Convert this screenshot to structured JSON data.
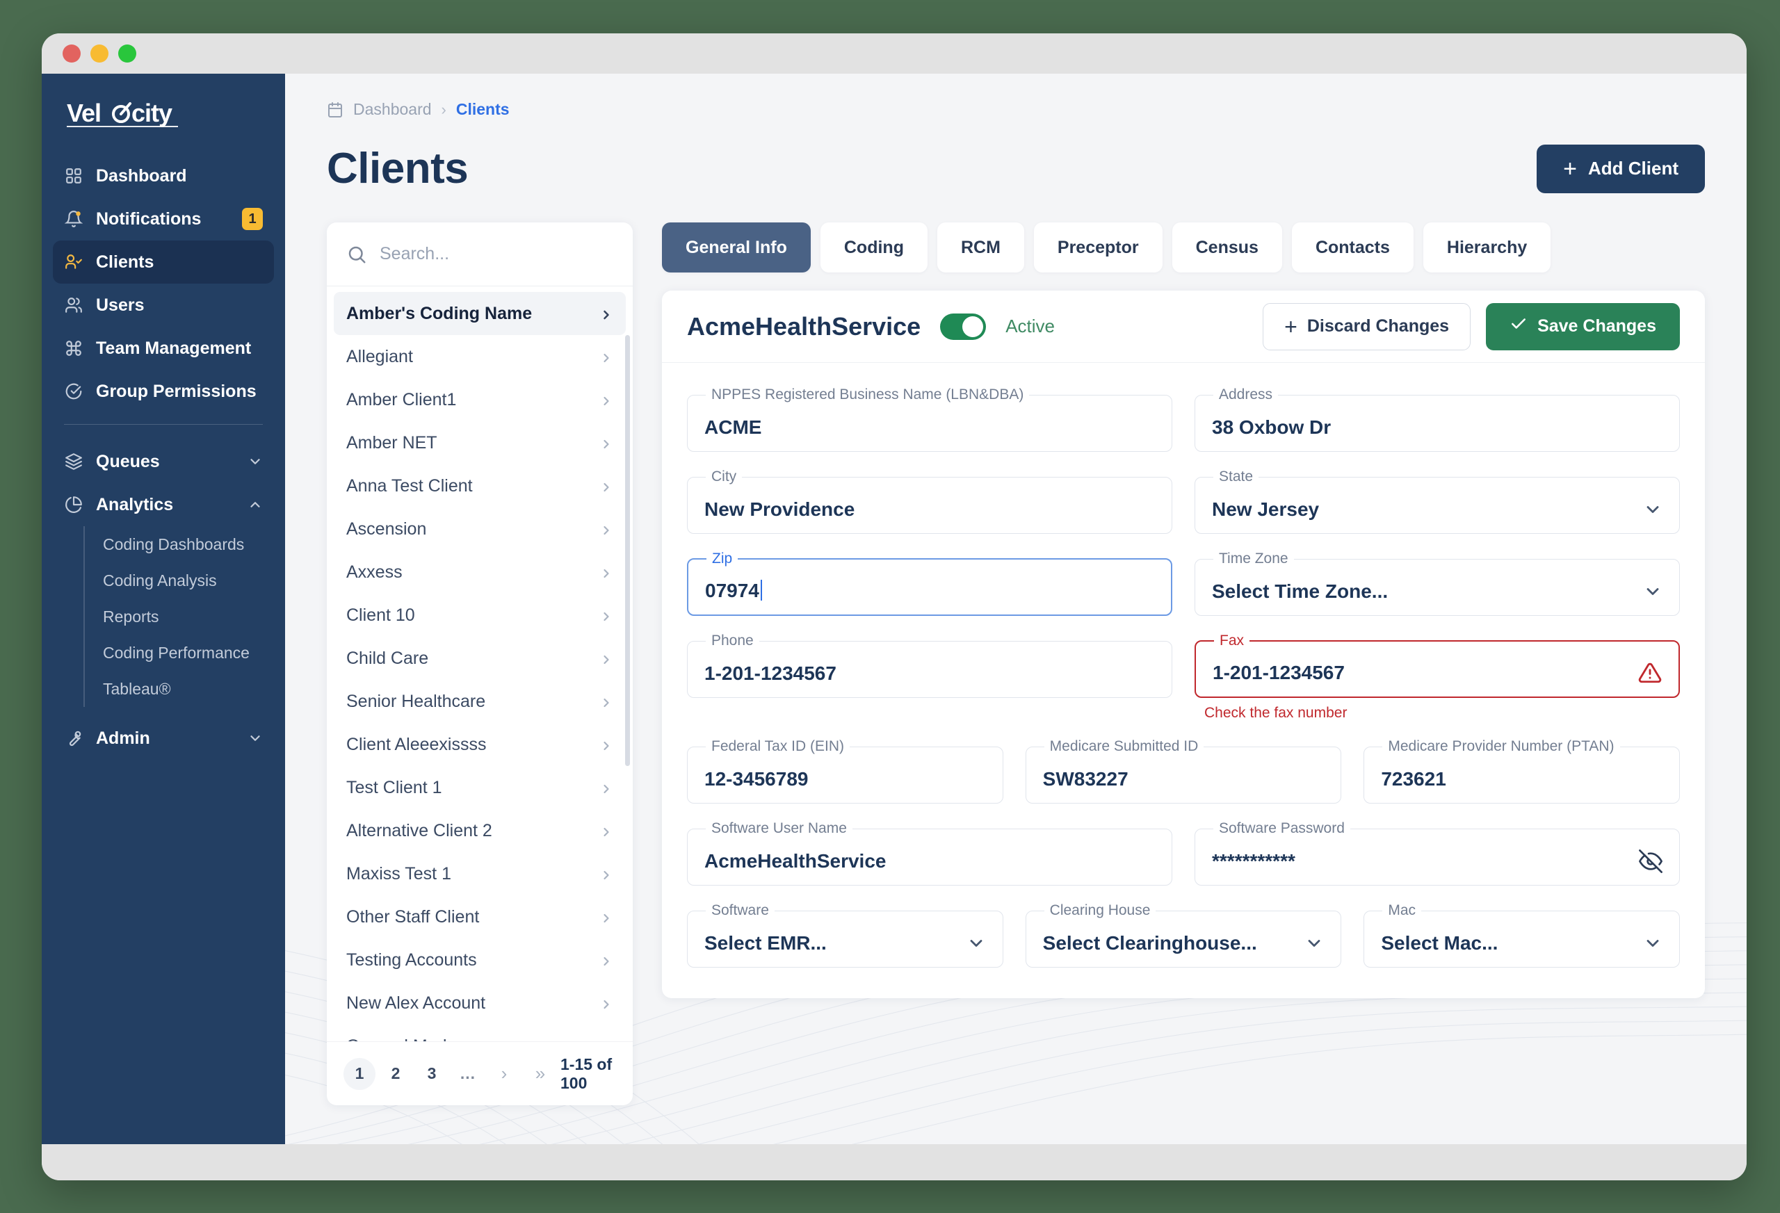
{
  "window": {
    "traffic_lights": [
      "close",
      "minimize",
      "maximize"
    ]
  },
  "sidebar": {
    "brand": "Velocity",
    "items": [
      {
        "label": "Dashboard",
        "icon": "grid-icon",
        "active": false
      },
      {
        "label": "Notifications",
        "icon": "bell-icon",
        "active": false,
        "badge": "1"
      },
      {
        "label": "Clients",
        "icon": "user-check-icon",
        "active": true
      },
      {
        "label": "Users",
        "icon": "users-icon",
        "active": false
      },
      {
        "label": "Team Management",
        "icon": "command-icon",
        "active": false
      },
      {
        "label": "Group Permissions",
        "icon": "check-circle-icon",
        "active": false
      }
    ],
    "groups": [
      {
        "label": "Queues",
        "icon": "layers-icon",
        "expanded": false,
        "chevron": "chevron-down-icon",
        "children": []
      },
      {
        "label": "Analytics",
        "icon": "pie-chart-icon",
        "expanded": true,
        "chevron": "chevron-up-icon",
        "children": [
          "Coding Dashboards",
          "Coding Analysis",
          "Reports",
          "Coding Performance",
          "Tableau®"
        ]
      },
      {
        "label": "Admin",
        "icon": "wrench-icon",
        "expanded": false,
        "chevron": "chevron-down-icon",
        "children": []
      }
    ]
  },
  "breadcrumb": {
    "icon": "calendar-icon",
    "root": "Dashboard",
    "separator": "›",
    "current": "Clients"
  },
  "page": {
    "title": "Clients",
    "add_button": "Add Client",
    "add_button_icon": "plus-icon"
  },
  "client_list": {
    "search_placeholder": "Search...",
    "search_value": "",
    "search_icon": "search-icon",
    "items": [
      {
        "name": "Amber's Coding Name",
        "selected": true
      },
      {
        "name": "Allegiant",
        "selected": false
      },
      {
        "name": "Amber Client1",
        "selected": false
      },
      {
        "name": "Amber NET",
        "selected": false
      },
      {
        "name": "Anna Test Client",
        "selected": false
      },
      {
        "name": "Ascension",
        "selected": false
      },
      {
        "name": "Axxess",
        "selected": false
      },
      {
        "name": "Client 10",
        "selected": false
      },
      {
        "name": "Child Care",
        "selected": false
      },
      {
        "name": "Senior Healthcare",
        "selected": false
      },
      {
        "name": "Client Aleeexissss",
        "selected": false
      },
      {
        "name": "Test Client 1",
        "selected": false
      },
      {
        "name": "Alternative Client 2",
        "selected": false
      },
      {
        "name": "Maxiss Test 1",
        "selected": false
      },
      {
        "name": "Other Staff Client",
        "selected": false
      },
      {
        "name": "Testing Accounts",
        "selected": false
      },
      {
        "name": "New Alex Account",
        "selected": false
      },
      {
        "name": "General Med",
        "selected": false
      }
    ],
    "pagination": {
      "pages": [
        "1",
        "2",
        "3"
      ],
      "current": "1",
      "ellipsis": "...",
      "next_icon": "›",
      "last_icon": "»",
      "summary": "1-15 of 100"
    }
  },
  "tabs": [
    {
      "label": "General Info",
      "active": true
    },
    {
      "label": "Coding",
      "active": false
    },
    {
      "label": "RCM",
      "active": false
    },
    {
      "label": "Preceptor",
      "active": false
    },
    {
      "label": "Census",
      "active": false
    },
    {
      "label": "Contacts",
      "active": false
    },
    {
      "label": "Hierarchy",
      "active": false
    }
  ],
  "detail": {
    "client_name": "AcmeHealthService",
    "status_toggle": {
      "on": true,
      "label": "Active"
    },
    "discard_button": "Discard Changes",
    "discard_icon": "plus-icon",
    "save_button": "Save Changes",
    "save_icon": "check-icon",
    "fields": {
      "business_name": {
        "label": "NPPES Registered Business Name (LBN&DBA)",
        "value": "ACME"
      },
      "address": {
        "label": "Address",
        "value": "38 Oxbow Dr"
      },
      "city": {
        "label": "City",
        "value": "New Providence"
      },
      "state": {
        "label": "State",
        "value": "New Jersey",
        "type": "select"
      },
      "zip": {
        "label": "Zip",
        "value": "07974",
        "focused": true
      },
      "timezone": {
        "label": "Time Zone",
        "value": "Select Time Zone...",
        "type": "select"
      },
      "phone": {
        "label": "Phone",
        "value": "1-201-1234567"
      },
      "fax": {
        "label": "Fax",
        "value": "1-201-1234567",
        "error": true,
        "error_message": "Check the fax number",
        "error_icon": "alert-triangle-icon"
      },
      "ein": {
        "label": "Federal Tax ID (EIN)",
        "value": "12-3456789"
      },
      "medicare_id": {
        "label": "Medicare Submitted ID",
        "value": "SW83227"
      },
      "ptan": {
        "label": "Medicare Provider Number (PTAN)",
        "value": "723621"
      },
      "software_user": {
        "label": "Software User Name",
        "value": "AcmeHealthService"
      },
      "software_pass": {
        "label": "Software Password",
        "value": "***********",
        "reveal_icon": "eye-off-icon"
      },
      "software": {
        "label": "Software",
        "value": "Select EMR...",
        "type": "select"
      },
      "clearing_house": {
        "label": "Clearing House",
        "value": "Select Clearinghouse...",
        "type": "select"
      },
      "mac": {
        "label": "Mac",
        "value": "Select Mac...",
        "type": "select"
      }
    }
  },
  "colors": {
    "sidebar_bg": "#233f63",
    "accent_blue": "#2f6fe4",
    "badge_yellow": "#f8bb32",
    "save_green": "#2a8258",
    "toggle_green": "#1f8a55",
    "error_red": "#c0282d",
    "page_bg": "#f4f5f7"
  }
}
